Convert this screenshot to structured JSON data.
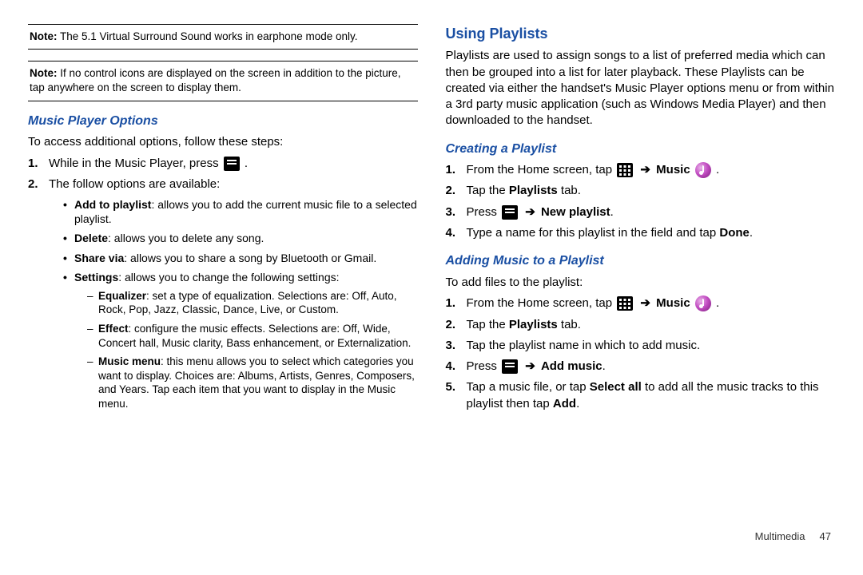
{
  "left": {
    "note1_lbl": "Note:",
    "note1": " The 5.1 Virtual Surround Sound works in earphone mode only.",
    "note2_lbl": "Note:",
    "note2": " If no control icons are displayed on the screen in addition to the picture, tap anywhere on the screen to display them.",
    "h3": "Music Player Options",
    "intro": "To access additional options, follow these steps:",
    "s1a": "While in the Music Player, press ",
    "s1b": " .",
    "s2": "The follow options are available:",
    "b1_t": "Add to playlist",
    "b1_r": ": allows you to add the current music file to a selected playlist.",
    "b2_t": "Delete",
    "b2_r": ": allows you to delete any song.",
    "b3_t": "Share via",
    "b3_r": ": allows you to share a song by Bluetooth or Gmail.",
    "b4_t": "Settings",
    "b4_r": ": allows you to change the following settings:",
    "d1_t": "Equalizer",
    "d1_r": ": set a type of equalization. Selections are: Off, Auto, Rock, Pop, Jazz, Classic, Dance, Live, or Custom.",
    "d2_t": "Effect",
    "d2_r": ": configure the music effects. Selections are: Off, Wide, Concert hall, Music clarity, Bass enhancement, or Externalization.",
    "d3_t": "Music menu",
    "d3_r": ": this menu allows you to select which categories you want to display. Choices are: Albums, Artists, Genres, Composers, and Years. Tap each item that you want to display in the Music menu."
  },
  "right": {
    "h2": "Using Playlists",
    "para": "Playlists are used to assign songs to a list of preferred media which can then be grouped into a list for later playback. These Playlists can be created via either the handset's Music Player options menu or from within a 3rd party music application (such as Windows Media Player) and then downloaded to the handset.",
    "h3a": "Creating a Playlist",
    "c1a": "From the Home screen, tap ",
    "c1_arrow": "➔",
    "c1_music": "Music",
    "c1b": " .",
    "c2a": "Tap the ",
    "c2b": "Playlists",
    "c2c": " tab.",
    "c3a": "Press ",
    "c3_arrow": "➔",
    "c3b": "New playlist",
    "c3c": ".",
    "c4a": "Type a name for this playlist in the field and tap ",
    "c4b": "Done",
    "c4c": ".",
    "h3b": "Adding Music to a Playlist",
    "intro2": "To add files to the playlist:",
    "a1a": "From the Home screen, tap ",
    "a1_arrow": "➔",
    "a1_music": "Music",
    "a1b": " .",
    "a2a": "Tap the ",
    "a2b": "Playlists",
    "a2c": " tab.",
    "a3": "Tap the playlist name in which to add music.",
    "a4a": "Press ",
    "a4_arrow": "➔",
    "a4b": "Add music",
    "a4c": ".",
    "a5a": "Tap a music file, or tap ",
    "a5b": "Select all",
    "a5c": " to add all the music tracks to this playlist then tap ",
    "a5d": "Add",
    "a5e": "."
  },
  "footer": {
    "section": "Multimedia",
    "page": "47"
  }
}
